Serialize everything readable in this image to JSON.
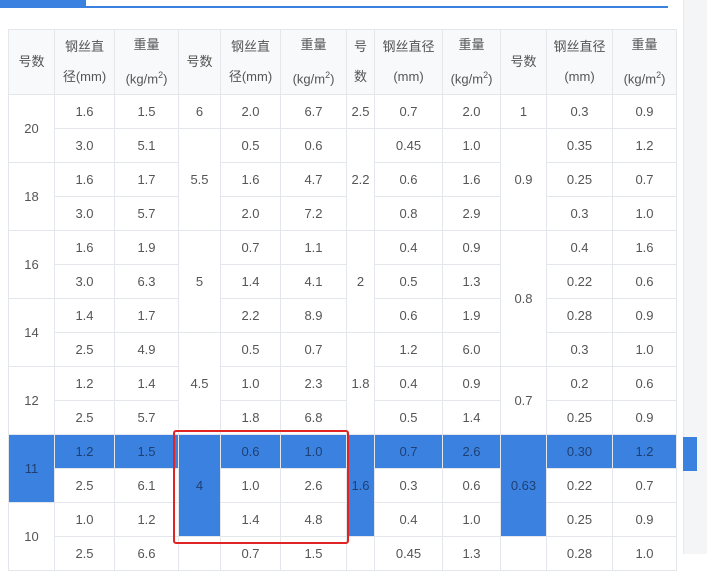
{
  "headers": [
    {
      "lines": [
        "号数"
      ]
    },
    {
      "lines": [
        "钢丝直",
        "径(mm)"
      ]
    },
    {
      "lines": [
        "重量",
        "(kg/m",
        "2",
        ")"
      ]
    },
    {
      "lines": [
        "号数"
      ]
    },
    {
      "lines": [
        "钢丝直",
        "径(mm)"
      ]
    },
    {
      "lines": [
        "重量",
        "(kg/m",
        "2",
        ")"
      ]
    },
    {
      "lines": [
        "号",
        "数"
      ]
    },
    {
      "lines": [
        "钢丝直径",
        "(mm)"
      ]
    },
    {
      "lines": [
        "重量",
        "(kg/m",
        "2",
        ")"
      ]
    },
    {
      "lines": [
        "号数"
      ]
    },
    {
      "lines": [
        "钢丝直径",
        "(mm)"
      ]
    },
    {
      "lines": [
        "重量",
        "(kg/m",
        "2",
        ")"
      ]
    }
  ],
  "group1": {
    "no": [
      "20",
      "18",
      "16",
      "14",
      "12",
      "11",
      "10"
    ],
    "d": [
      "1.6",
      "3.0",
      "1.6",
      "3.0",
      "1.6",
      "3.0",
      "1.4",
      "2.5",
      "1.2",
      "2.5",
      "1.2",
      "2.5",
      "1.0",
      "2.5"
    ],
    "w": [
      "1.5",
      "5.1",
      "1.7",
      "5.7",
      "1.9",
      "6.3",
      "1.7",
      "4.9",
      "1.4",
      "5.7",
      "1.5",
      "6.1",
      "1.2",
      "6.6"
    ]
  },
  "group2": {
    "no": [
      "6",
      "5.5",
      "5",
      "4.5",
      "4"
    ],
    "d": [
      "2.0",
      "0.5",
      "1.6",
      "2.0",
      "0.7",
      "1.4",
      "2.2",
      "0.5",
      "1.0",
      "1.8",
      "0.6",
      "1.0",
      "1.4",
      "0.7"
    ],
    "w": [
      "6.7",
      "0.6",
      "4.7",
      "7.2",
      "1.1",
      "4.1",
      "8.9",
      "0.7",
      "2.3",
      "6.8",
      "1.0",
      "2.6",
      "4.8",
      "1.5"
    ]
  },
  "group3": {
    "no": [
      "2.5",
      "2.2",
      "2",
      "1.8",
      "1.6"
    ],
    "d": [
      "0.7",
      "0.45",
      "0.6",
      "0.8",
      "0.4",
      "0.5",
      "0.6",
      "1.2",
      "0.4",
      "0.5",
      "0.7",
      "0.3",
      "0.4",
      "0.45"
    ],
    "w": [
      "2.0",
      "1.0",
      "1.6",
      "2.9",
      "0.9",
      "1.3",
      "1.9",
      "6.0",
      "0.9",
      "1.4",
      "2.6",
      "0.6",
      "1.0",
      "1.3"
    ]
  },
  "group4": {
    "no": [
      "1",
      "0.9",
      "0.8",
      "0.7",
      "0.63"
    ],
    "d": [
      "0.3",
      "0.35",
      "0.25",
      "0.3",
      "0.4",
      "0.22",
      "0.28",
      "0.3",
      "0.2",
      "0.25",
      "0.30",
      "0.22",
      "0.25",
      "0.28"
    ],
    "w": [
      "0.9",
      "1.2",
      "0.7",
      "1.0",
      "1.6",
      "0.6",
      "0.9",
      "1.0",
      "0.6",
      "0.9",
      "1.2",
      "0.7",
      "0.9",
      "1.0"
    ]
  },
  "colors": {
    "accent": "#3b82e0",
    "selection": "#e02424",
    "border": "#e3e6ea"
  }
}
